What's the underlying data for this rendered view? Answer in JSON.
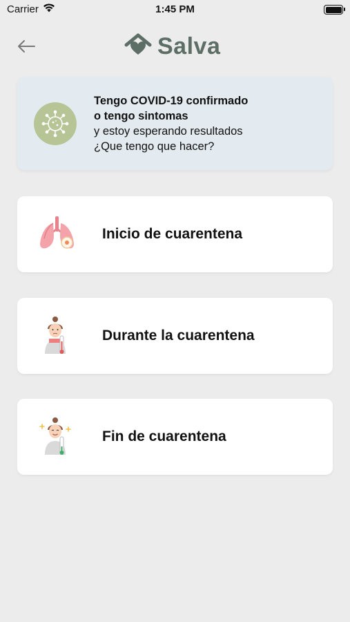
{
  "status_bar": {
    "carrier": "Carrier",
    "time": "1:45 PM"
  },
  "header": {
    "logo_text": "Salva",
    "back_icon": "arrow-left-icon",
    "logo_icon": "house-heart-icon",
    "brand_color": "#5d6e67"
  },
  "banner": {
    "line1": "Tengo COVID-19 confirmado",
    "line2": "o tengo sintomas",
    "line3": "y estoy esperando resultados",
    "line4": "¿Que tengo que hacer?",
    "icon": "virus-icon",
    "icon_bg": "#b6c496",
    "background": "#e4ebf0"
  },
  "cards": [
    {
      "label": "Inicio de cuarentena",
      "icon": "lungs-icon"
    },
    {
      "label": "Durante la cuarentena",
      "icon": "sick-person-icon"
    },
    {
      "label": "Fin de cuarentena",
      "icon": "recovered-person-icon"
    }
  ]
}
